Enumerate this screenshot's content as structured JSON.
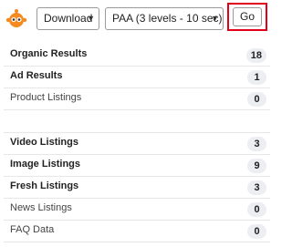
{
  "toolbar": {
    "download_select": "Download",
    "paa_select": "PAA (3 levels - 10 sec)",
    "go_label": "Go",
    "highlight_color": "#e3001b",
    "logo_color": "#f58a1f"
  },
  "results": [
    {
      "label": "Organic Results",
      "count": "18",
      "bold": true
    },
    {
      "label": "Ad Results",
      "count": "1",
      "bold": true
    },
    {
      "label": "Product Listings",
      "count": "0",
      "bold": false
    },
    {
      "label": "",
      "count": "",
      "bold": false,
      "spacer": true
    },
    {
      "label": "Video Listings",
      "count": "3",
      "bold": true
    },
    {
      "label": "Image Listings",
      "count": "9",
      "bold": true
    },
    {
      "label": "Fresh Listings",
      "count": "3",
      "bold": true
    },
    {
      "label": "News Listings",
      "count": "0",
      "bold": false
    },
    {
      "label": "FAQ Data",
      "count": "0",
      "bold": false
    }
  ]
}
